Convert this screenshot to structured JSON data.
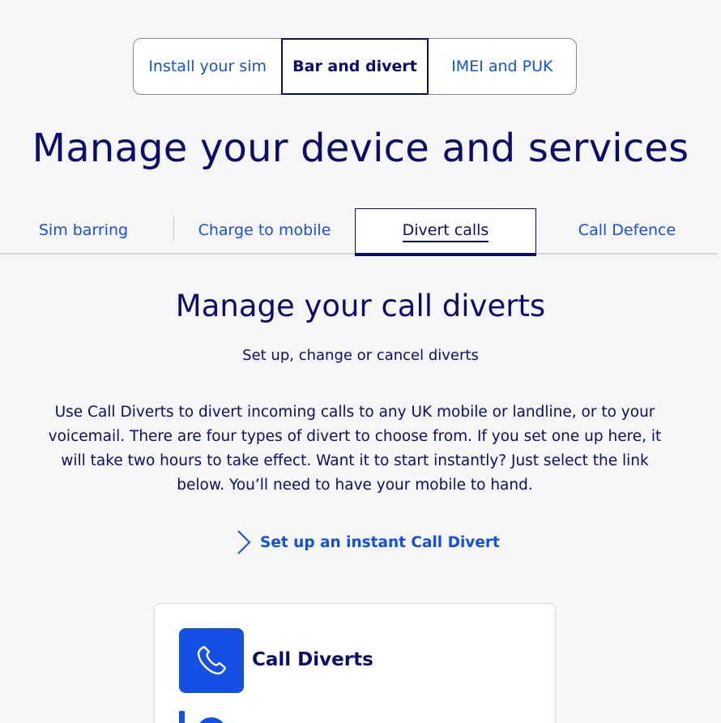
{
  "top_tabs": [
    {
      "label": "Install your sim",
      "active": false
    },
    {
      "label": "Bar and divert",
      "active": true
    },
    {
      "label": "IMEI and PUK",
      "active": false
    }
  ],
  "page_title": "Manage your device and services",
  "sub_tabs": [
    {
      "label": "Sim barring",
      "active": false
    },
    {
      "label": "Charge to mobile",
      "active": false
    },
    {
      "label": "Divert calls",
      "active": true
    },
    {
      "label": "Call Defence",
      "active": false
    }
  ],
  "section": {
    "title": "Manage your call diverts",
    "subtitle": "Set up, change or cancel diverts",
    "body": "Use Call Diverts to divert incoming calls to any UK mobile or landline, or to your voicemail. There are four types of divert to choose from. If you set one up here, it will take two hours to take effect. Want it to start instantly? Just select the link below. You’ll need to have your mobile to hand.",
    "cta_label": "Set up an instant Call Divert"
  },
  "card": {
    "title": "Call Diverts",
    "icon": "phone-icon"
  },
  "colors": {
    "navy": "#0b0d6e",
    "link_blue": "#1450e6",
    "background": "#f6f6f6"
  }
}
